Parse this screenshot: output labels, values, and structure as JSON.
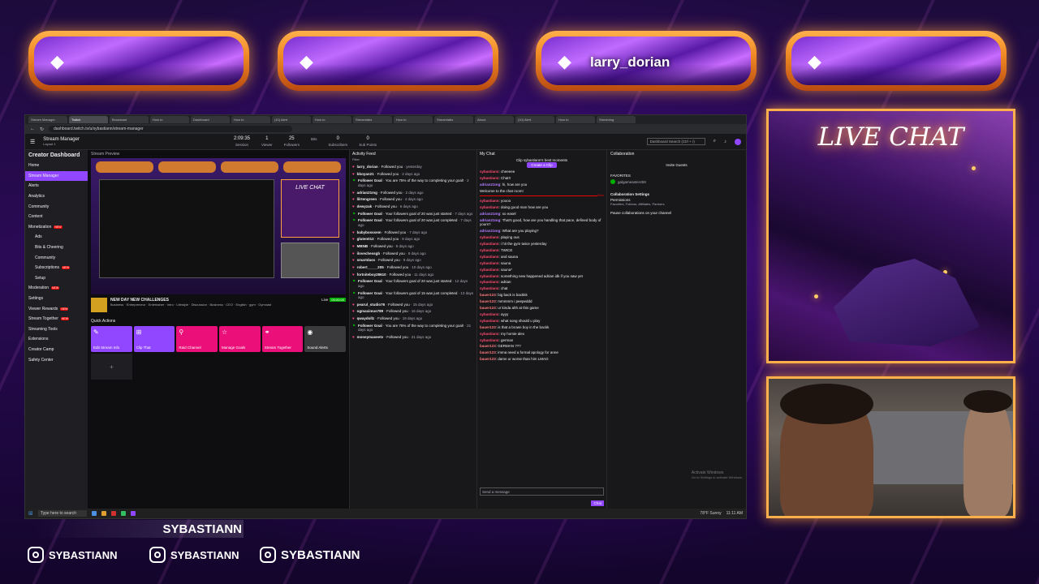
{
  "overlay": {
    "alerts": [
      "",
      "",
      "larry_dorian",
      ""
    ],
    "live_chat_title": "LIVE CHAT",
    "banner_name": "SYBASTIANN",
    "socials": [
      "SYBASTIANN",
      "SYBASTIANN",
      "SYBASTIANN"
    ]
  },
  "browser": {
    "tabs": [
      "Stream Manager",
      "Twitch",
      "Broadcast",
      "How to",
      "Dashboard",
      "How to",
      "(10) Alert",
      "How to",
      "Streamlabs",
      "How to",
      "Streamlabs",
      "About",
      "(10) Alert",
      "How to",
      "Streaming"
    ],
    "url": "dashboard.twitch.tv/u/sybastiann/stream-manager"
  },
  "topbar": {
    "menu": "Stream Manager",
    "menu_sub": "Layout 1",
    "stats": [
      {
        "value": "2:09:35",
        "label": "Session"
      },
      {
        "value": "1",
        "label": "Viewer"
      },
      {
        "value": "25",
        "label": "Followers"
      },
      {
        "value": "",
        "label": "Bits"
      },
      {
        "value": "0",
        "label": "Subscribers"
      },
      {
        "value": "0",
        "label": "Sub Points"
      }
    ],
    "search_placeholder": "Dashboard Search (Ctrl + /)"
  },
  "sidebar": {
    "title": "Creator Dashboard",
    "items": [
      {
        "label": "Home",
        "type": "item"
      },
      {
        "label": "Stream Manager",
        "type": "sel"
      },
      {
        "label": "Alerts",
        "type": "item"
      },
      {
        "label": "Analytics",
        "type": "item"
      },
      {
        "label": "Community",
        "type": "item"
      },
      {
        "label": "Content",
        "type": "item"
      },
      {
        "label": "Monetization",
        "type": "item",
        "badge": "NEW"
      },
      {
        "label": "Ads",
        "type": "sub"
      },
      {
        "label": "Bits & Cheering",
        "type": "sub"
      },
      {
        "label": "Community",
        "type": "sub"
      },
      {
        "label": "Subscriptions",
        "type": "sub",
        "badge": "NEW"
      },
      {
        "label": "Setup",
        "type": "sub"
      },
      {
        "label": "Moderation",
        "type": "item",
        "badge": "NEW"
      },
      {
        "label": "Settings",
        "type": "item"
      },
      {
        "label": "Viewer Rewards",
        "type": "item",
        "badge": "NEW"
      },
      {
        "label": "Stream Together",
        "type": "item",
        "badge": "NEW"
      },
      {
        "label": "Streaming Tools",
        "type": "item"
      },
      {
        "label": "Extensions",
        "type": "item"
      },
      {
        "label": "Creator Camp",
        "type": "item"
      },
      {
        "label": "Safety Center",
        "type": "item"
      }
    ]
  },
  "preview": {
    "header": "Stream Preview",
    "mini_title": "LIVE CHAT",
    "stream_title": "NEW DAY NEW CHALLENGES",
    "tags": "Business · Entrepreneur · Entertainer · Intro · Lifestyle · Discussion · Business · CEO · English · gym · Gymnast",
    "live_label": "Live",
    "live_badge": "00:00:00",
    "quick_actions": "Quick Actions",
    "buttons": [
      {
        "label": "Edit Stream Info",
        "color": "#9147ff",
        "icon": "✎"
      },
      {
        "label": "Clip That",
        "color": "#9147ff",
        "icon": "⊞"
      },
      {
        "label": "Raid Channel",
        "color": "#eb0f7a",
        "icon": "⚲"
      },
      {
        "label": "Manage Goals",
        "color": "#eb0f7a",
        "icon": "☆"
      },
      {
        "label": "Stream Together",
        "color": "#eb0f7a",
        "icon": "⚭"
      },
      {
        "label": "Sound Alerts",
        "color": "#3a3a3d",
        "icon": "◉"
      }
    ],
    "add_label": "+"
  },
  "feed": {
    "header": "Activity Feed",
    "filter": "Filter",
    "items": [
      {
        "kind": "follow",
        "user": "larry_dorian",
        "text": "Followed you",
        "time": "yesterday"
      },
      {
        "kind": "follow",
        "user": "bboyan21",
        "text": "Followed you",
        "time": "2 days ago"
      },
      {
        "kind": "goal",
        "user": "Follower Goal",
        "text": "You are 75% of the way to completing your goal!",
        "time": "2 days ago"
      },
      {
        "kind": "follow",
        "user": "adrian21mg",
        "text": "Followed you",
        "time": "2 days ago"
      },
      {
        "kind": "follow",
        "user": "lilrtengreen",
        "text": "Followed you",
        "time": "4 days ago"
      },
      {
        "kind": "follow",
        "user": "dewyzak",
        "text": "Followed you",
        "time": "6 days ago"
      },
      {
        "kind": "goal",
        "user": "Follower Goal",
        "text": "Your followers goal of 20 was just started",
        "time": "7 days ago"
      },
      {
        "kind": "goal",
        "user": "Follower Goal",
        "text": "Your followers goal of 20 was just completed",
        "time": "7 days ago"
      },
      {
        "kind": "follow",
        "user": "babybosssem",
        "text": "Followed you",
        "time": "7 days ago"
      },
      {
        "kind": "follow",
        "user": "gluten012",
        "text": "Followed you",
        "time": "8 days ago"
      },
      {
        "kind": "follow",
        "user": "MBNB",
        "text": "Followed you",
        "time": "8 days ago"
      },
      {
        "kind": "follow",
        "user": "ilovechessgb",
        "text": "Followed you",
        "time": "8 days ago"
      },
      {
        "kind": "follow",
        "user": "smartdass",
        "text": "Followed you",
        "time": "9 days ago"
      },
      {
        "kind": "follow",
        "user": "robert_____205",
        "text": "Followed you",
        "time": "10 days ago"
      },
      {
        "kind": "follow",
        "user": "fortniteboy28610",
        "text": "Followed you",
        "time": "11 days ago"
      },
      {
        "kind": "goal",
        "user": "Follower Goal",
        "text": "Your followers goal of 20 was just started",
        "time": "12 days ago"
      },
      {
        "kind": "goal",
        "user": "Follower Goal",
        "text": "Your followers goal of 15 was just completed",
        "time": "13 days ago"
      },
      {
        "kind": "follow",
        "user": "pearul_studio76",
        "text": "Followed you",
        "time": "15 days ago"
      },
      {
        "kind": "follow",
        "user": "ogmaximus789",
        "text": "Followed you",
        "time": "16 days ago"
      },
      {
        "kind": "follow",
        "user": "qwaydollz",
        "text": "Followed you",
        "time": "19 days ago"
      },
      {
        "kind": "goal",
        "user": "Follower Goal",
        "text": "You are 75% of the way to completing your goal!",
        "time": "21 days ago"
      },
      {
        "kind": "follow",
        "user": "moneymaseetv",
        "text": "Followed you",
        "time": "21 days ago"
      }
    ]
  },
  "chat": {
    "header": "My Chat",
    "clip_title": "Clip sybastiann's best moments",
    "clip_button": "Create a Clip",
    "new_label": "New",
    "input_placeholder": "Send a message",
    "chat_button": "Chat",
    "lines": [
      {
        "u": "sybastiann",
        "c": "u1",
        "m": "cheeeee"
      },
      {
        "u": "sybastiann",
        "c": "u1",
        "m": "Chat!!"
      },
      {
        "u": "adrian21mg",
        "c": "u2",
        "m": "hi, how are you"
      },
      {
        "u": "",
        "c": "u2",
        "m": "Welcome to the chat room!"
      },
      {
        "u": "sybastiann",
        "c": "u1",
        "m": "yoooo"
      },
      {
        "u": "sybastiann",
        "c": "u1",
        "m": "doing good man how are you"
      },
      {
        "u": "adrian21mg",
        "c": "u2",
        "m": "so easel"
      },
      {
        "u": "adrian21mg",
        "c": "u2",
        "m": "That's good, how are you handling that pace, defined body of yours?"
      },
      {
        "u": "adrian21mg",
        "c": "u2",
        "m": "What are you playing?"
      },
      {
        "u": "sybastiann",
        "c": "u1",
        "m": "playing ous"
      },
      {
        "u": "sybastiann",
        "c": "u1",
        "m": "i hit the gym twice yesterday"
      },
      {
        "u": "sybastiann",
        "c": "u1",
        "m": "TWICE"
      },
      {
        "u": "sybastiann",
        "c": "u1",
        "m": "and sauna"
      },
      {
        "u": "sybastiann",
        "c": "u1",
        "m": "sauna"
      },
      {
        "u": "sybastiann",
        "c": "u1",
        "m": "sauna*"
      },
      {
        "u": "sybastiann",
        "c": "u1",
        "m": "something new happened adrian idk if you saw yet"
      },
      {
        "u": "sybastiann",
        "c": "u1",
        "m": "adrian"
      },
      {
        "u": "sybastiann",
        "c": "u1",
        "m": "chat"
      },
      {
        "u": "bauer123",
        "c": "u3",
        "m": "big back is backkk"
      },
      {
        "u": "bauer123",
        "c": "u3",
        "m": "mmmmm i peepeddd"
      },
      {
        "u": "bauer123",
        "c": "u3",
        "m": "ur kinda ahh at this game"
      },
      {
        "u": "sybastiann",
        "c": "u1",
        "m": "ayyy"
      },
      {
        "u": "sybastiann",
        "c": "u1",
        "m": "what song should u play"
      },
      {
        "u": "bauer123",
        "c": "u3",
        "m": "is that a brown boy in the backk"
      },
      {
        "u": "sybastiann",
        "c": "u1",
        "m": "my homie alex"
      },
      {
        "u": "sybastiann",
        "c": "u1",
        "m": "german"
      },
      {
        "u": "bauer123",
        "c": "u3",
        "m": "GERMAN ???"
      },
      {
        "u": "bauer123",
        "c": "u3",
        "m": "imma need a formal apology for anne"
      },
      {
        "u": "bauer123",
        "c": "u3",
        "m": "damn ur worse than him LMAO"
      }
    ]
  },
  "collab": {
    "header": "Collaboration",
    "invite": "Invite Guests",
    "favorites": "FAVORITES",
    "fav_user": "galgameaster459",
    "settings": "Collaboration Settings",
    "permissions": "Permissions",
    "permissions_sub": "Favorites, Follows, Affiliates, Partners",
    "pause": "Pause collaborations on your channel",
    "activate_title": "Activate Windows",
    "activate_sub": "Go to Settings to activate Windows."
  },
  "taskbar": {
    "search": "Type here to search",
    "weather": "78°F Sunny",
    "time": "11:11 AM"
  }
}
